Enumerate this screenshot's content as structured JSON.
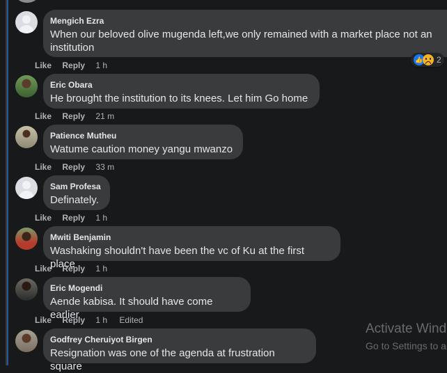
{
  "comments": [
    {
      "author": "Mengich Ezra",
      "text": "When our beloved olive mugenda left,we only remained with a market place not an institution",
      "like": "Like",
      "reply": "Reply",
      "time": "1 h",
      "reactions": {
        "count": "2",
        "types": [
          "like-icon",
          "sad-icon"
        ]
      }
    },
    {
      "author": "Eric Obara",
      "text": "He brought the institution to its knees. Let him Go home",
      "like": "Like",
      "reply": "Reply",
      "time": "21 m"
    },
    {
      "author": "Patience Mutheu",
      "text": "Watume caution money yangu mwanzo",
      "like": "Like",
      "reply": "Reply",
      "time": "33 m"
    },
    {
      "author": "Sam Profesa",
      "text": "Definately.",
      "like": "Like",
      "reply": "Reply",
      "time": "1 h"
    },
    {
      "author": "Mwiti Benjamin",
      "text": "Washaking shouldn't have been the vc of Ku at the first place",
      "like": "Like",
      "reply": "Reply",
      "time": "1 h"
    },
    {
      "author": "Eric Mogendi",
      "text": "Aende kabisa. It should have come earlier",
      "like": "Like",
      "reply": "Reply",
      "time": "1 h",
      "edited": "Edited"
    },
    {
      "author": "Godfrey Cheruiyot Birgen",
      "text": "Resignation was one of the agenda at frustration square"
    }
  ],
  "watermark": {
    "title": "Activate Windows",
    "subtitle": "Go to Settings to activate Windows."
  },
  "colors": {
    "background": "#18191a",
    "bubble": "#3a3b3c",
    "text": "#e4e6eb",
    "secondary": "#b0b3b8",
    "accent": "#2d88ff"
  }
}
